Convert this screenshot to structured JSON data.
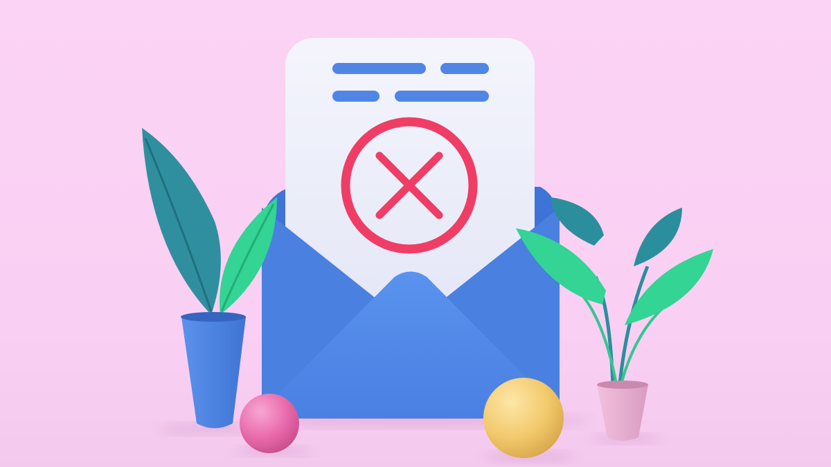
{
  "scene": {
    "subject": "envelope-with-rejected-letter",
    "icons": [
      "x-mark-icon",
      "document-line-icon",
      "envelope-icon",
      "potted-plant-icon",
      "sphere-icon"
    ],
    "colors": {
      "background": "#fbd3f4",
      "envelope": "#4f86e6",
      "envelope_dark": "#3f72d4",
      "paper": "#eef0fb",
      "doc_lines": "#4f86e6",
      "x_mark": "#ef3d66",
      "leaf_teal": "#2f8f9e",
      "leaf_green": "#33d494",
      "pot_blue": "#4f86e6",
      "pot_pink": "#eab0cf",
      "ball_pink": "#ec6fb0",
      "ball_yellow": "#f2cf7a"
    }
  }
}
